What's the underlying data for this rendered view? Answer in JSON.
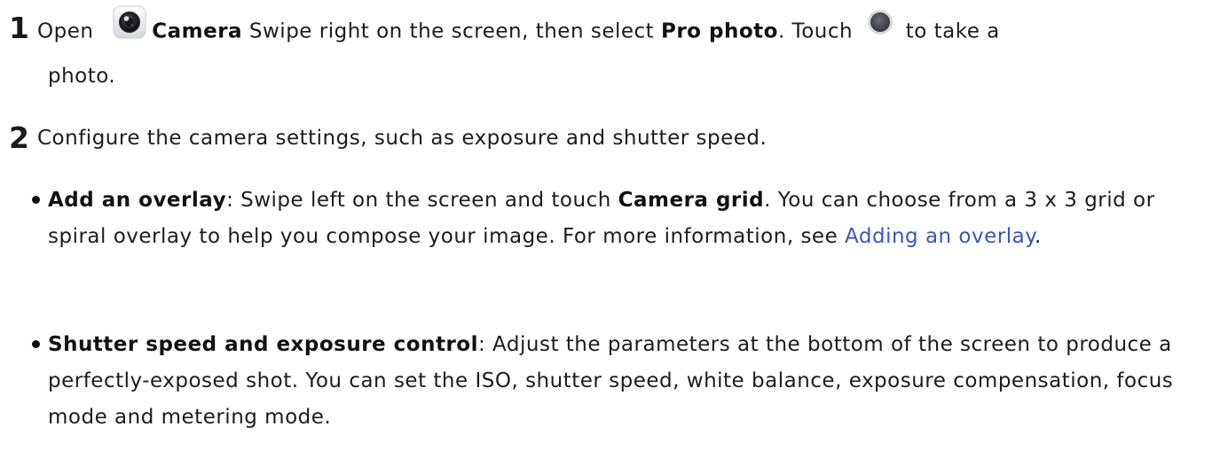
{
  "steps": [
    {
      "number": "1",
      "open_text": "Open",
      "camera_label": "Camera",
      "swipe_text": "Swipe right on the screen, then select",
      "pro_photo_label": "Pro photo",
      "touch_text": ". Touch",
      "take_text": "to take a",
      "continuation": "photo."
    },
    {
      "number": "2",
      "text": "Configure the camera settings, such as exposure and shutter speed."
    }
  ],
  "bullets": [
    {
      "title": "Add an overlay",
      "text_before": ": Swipe left on the screen and touch",
      "bold_inline": "Camera grid",
      "text_after": ". You can choose from a 3 x 3 grid or spiral overlay to help you compose your image. For more information, see",
      "link_text": "Adding an overlay",
      "text_end": "."
    },
    {
      "title": "Shutter speed and exposure control",
      "text": ": Adjust the parameters at the bottom of the screen to produce a perfectly-exposed shot. You can set the ISO, shutter speed, white balance, exposure compensation, focus mode and metering mode."
    }
  ],
  "icons": {
    "camera": "camera-app-icon",
    "shutter": "shutter-button-icon"
  },
  "colors": {
    "link": "#3a57b4",
    "text": "#1c1c1c"
  }
}
